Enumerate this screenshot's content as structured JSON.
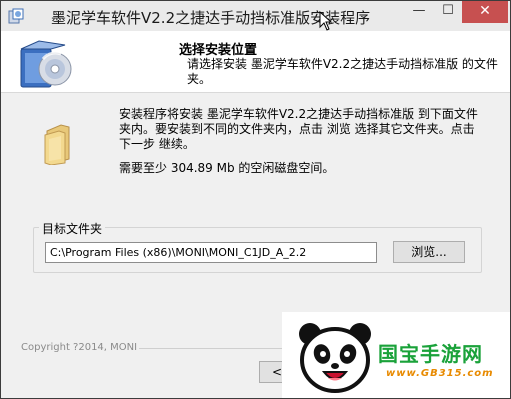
{
  "window": {
    "title": "墨泥学车软件V2.2之捷达手动挡标准版安装程序",
    "minimize_glyph": "—",
    "maximize_glyph": "☐",
    "close_glyph": "✕"
  },
  "header": {
    "title": "选择安装位置",
    "subtitle": "请选择安装 墨泥学车软件V2.2之捷达手动挡标准版 的文件夹。"
  },
  "body": {
    "instruction": "安装程序将安装 墨泥学车软件V2.2之捷达手动挡标准版 到下面文件夹内。要安装到不同的文件夹内，点击 浏览 选择其它文件夹。点击 下一步 继续。",
    "space_required": "需要至少 304.89 Mb 的空闲磁盘空间。"
  },
  "destination": {
    "label": "目标文件夹",
    "path": "C:\\Program Files (x86)\\MONI\\MONI_C1JD_A_2.2",
    "browse_label": "浏览..."
  },
  "footer": {
    "copyright": "Copyright ?2014, MONI",
    "back_label": "< "
  },
  "watermark": {
    "brand": "国宝手游网",
    "url": "www.GB315.com"
  },
  "colors": {
    "close_red": "#c75050",
    "watermark_green": "#1aa23a",
    "watermark_orange": "#e88a00"
  },
  "icons": [
    "installer-app-icon",
    "install-disc-icon",
    "folder-icon",
    "panda-logo-icon"
  ]
}
